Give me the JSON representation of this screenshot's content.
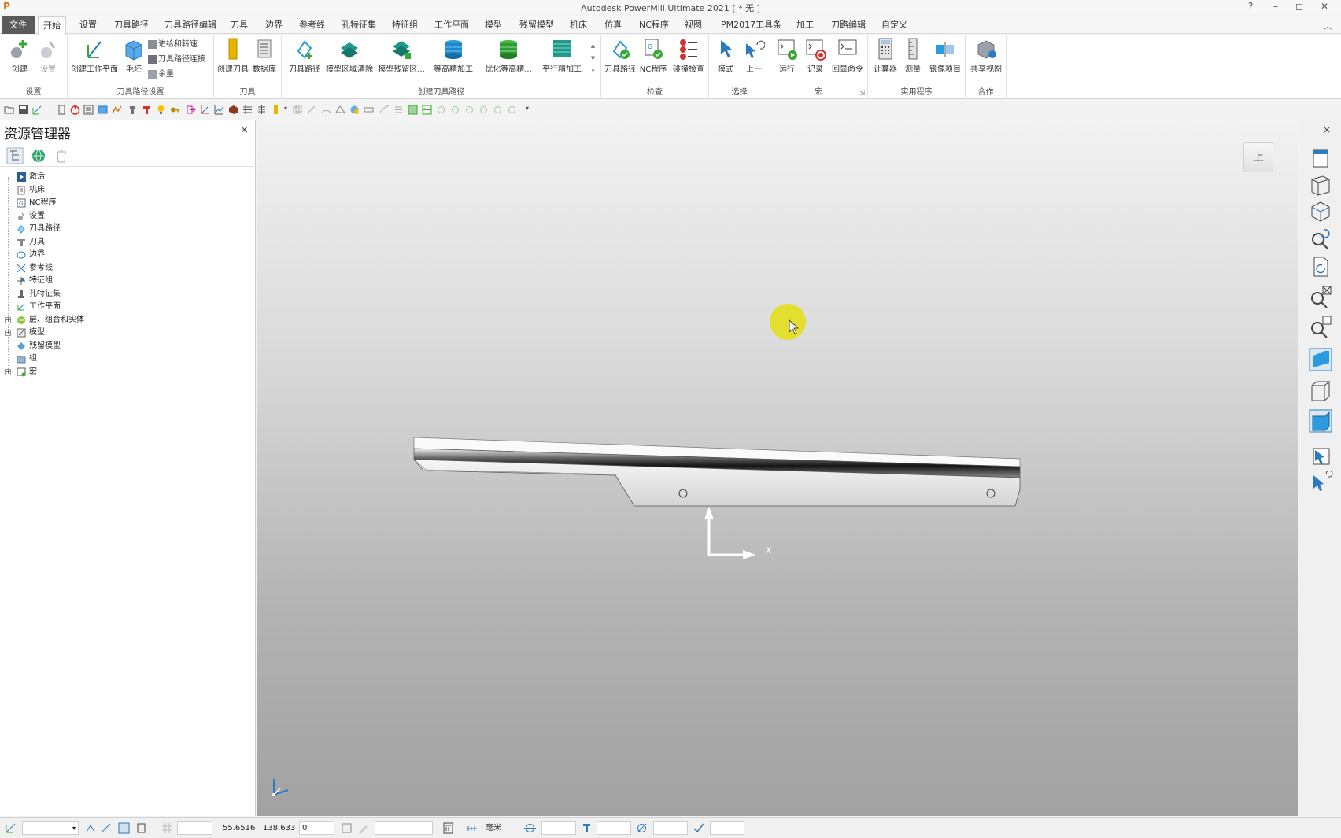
{
  "window": {
    "title": "Autodesk PowerMill Ultimate 2021   [ * 无 ]",
    "app_icon": "P",
    "help": "?",
    "minimize": "–",
    "maximize": "◻",
    "close": "✕"
  },
  "tabs": [
    "文件",
    "开始",
    "设置",
    "刀具路径",
    "刀具路径编辑",
    "刀具",
    "边界",
    "参考线",
    "孔特征集",
    "特征组",
    "工作平面",
    "模型",
    "残留模型",
    "机床",
    "仿真",
    "NC程序",
    "视图",
    "PM2017工具条",
    "加工",
    "刀路编辑",
    "自定义"
  ],
  "active_tab": "开始",
  "ribbon": {
    "groups": {
      "setup": "设置",
      "toolpath_setup": "刀具路径设置",
      "tool": "刀具",
      "create_toolpath": "创建刀具路径",
      "verify": "检查",
      "select": "选择",
      "macro": "宏",
      "utilities": "实用程序",
      "collaborate": "合作"
    },
    "buttons": {
      "create": "创建",
      "settings": "设置",
      "create_workplane": "创建工作平面",
      "block": "毛坯",
      "leads_links": "进给和转速",
      "toolpath_connections": "刀具路径连接",
      "feedrate": "余量",
      "create_tool": "创建刀具",
      "database": "数据库",
      "toolpath": "刀具路径",
      "model_area_clear": "模型区域清除",
      "model_rest_area": "模型残留区...",
      "constant_z_finish": "等高精加工",
      "optimized_constant_z": "优化等高精...",
      "parallel_finish": "平行精加工",
      "verify_toolpath": "刀具路径",
      "nc_program": "NC程序",
      "collision_check": "碰撞检查",
      "mode": "模式",
      "previous": "上一",
      "run": "运行",
      "record": "记录",
      "echo_commands": "回显命令",
      "calculator": "计算器",
      "measure": "测量",
      "mirror_project": "镜像项目",
      "share_view": "共享视图"
    }
  },
  "explorer": {
    "title": "资源管理器",
    "close": "×",
    "items": [
      {
        "label": "激活",
        "expandable": false
      },
      {
        "label": "机床",
        "expandable": false
      },
      {
        "label": "NC程序",
        "expandable": false
      },
      {
        "label": "设置",
        "expandable": false
      },
      {
        "label": "刀具路径",
        "expandable": false
      },
      {
        "label": "刀具",
        "expandable": false
      },
      {
        "label": "边界",
        "expandable": false
      },
      {
        "label": "参考线",
        "expandable": false
      },
      {
        "label": "特征组",
        "expandable": false
      },
      {
        "label": "孔特征集",
        "expandable": false
      },
      {
        "label": "工作平面",
        "expandable": false
      },
      {
        "label": "层、组合和实体",
        "expandable": true
      },
      {
        "label": "模型",
        "expandable": true
      },
      {
        "label": "残留模型",
        "expandable": false
      },
      {
        "label": "组",
        "expandable": false
      },
      {
        "label": "宏",
        "expandable": true
      }
    ]
  },
  "viewport": {
    "viewcube_label": "上",
    "axis_x_label": "X"
  },
  "rightbar": {
    "close": "×"
  },
  "statusbar": {
    "coord_x": "55.6516",
    "coord_y": "138.633",
    "coord_z": "0",
    "units": "毫米"
  },
  "colors": {
    "accent_blue": "#2b7bc0",
    "file_tab": "#5a5a5a",
    "cursor_highlight": "#e3df1c"
  }
}
